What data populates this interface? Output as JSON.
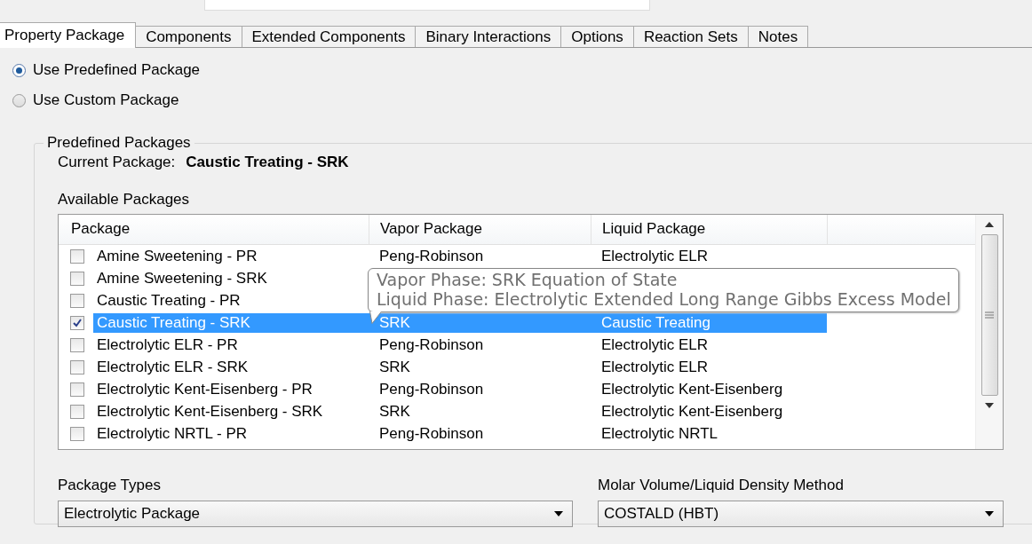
{
  "tabs": [
    {
      "label": "Property Package",
      "selected": true
    },
    {
      "label": "Components",
      "selected": false
    },
    {
      "label": "Extended Components",
      "selected": false
    },
    {
      "label": "Binary Interactions",
      "selected": false
    },
    {
      "label": "Options",
      "selected": false
    },
    {
      "label": "Reaction Sets",
      "selected": false
    },
    {
      "label": "Notes",
      "selected": false
    }
  ],
  "package_mode": [
    {
      "label": "Use Predefined Package",
      "selected": true
    },
    {
      "label": "Use Custom Package",
      "selected": false
    }
  ],
  "predefined_packages": {
    "title": "Predefined Packages",
    "current_label": "Current Package:",
    "current_value": "Caustic Treating - SRK",
    "available_label": "Available Packages",
    "columns": [
      "Package",
      "Vapor Package",
      "Liquid Package"
    ],
    "rows": [
      {
        "package": "Amine Sweetening - PR",
        "vapor": "Peng-Robinson",
        "liquid": "Electrolytic ELR",
        "checked": false,
        "selected": false
      },
      {
        "package": "Amine Sweetening - SRK",
        "checked": false,
        "selected": false
      },
      {
        "package": "Caustic Treating - PR",
        "checked": false,
        "selected": false
      },
      {
        "package": "Caustic Treating - SRK",
        "vapor": "SRK",
        "liquid": "Caustic Treating",
        "checked": true,
        "selected": true
      },
      {
        "package": "Electrolytic ELR - PR",
        "vapor": "Peng-Robinson",
        "liquid": "Electrolytic ELR",
        "checked": false,
        "selected": false
      },
      {
        "package": "Electrolytic ELR - SRK",
        "vapor": "SRK",
        "liquid": "Electrolytic ELR",
        "checked": false,
        "selected": false
      },
      {
        "package": "Electrolytic Kent-Eisenberg - PR",
        "vapor": "Peng-Robinson",
        "liquid": "Electrolytic Kent-Eisenberg",
        "checked": false,
        "selected": false
      },
      {
        "package": "Electrolytic Kent-Eisenberg - SRK",
        "vapor": "SRK",
        "liquid": "Electrolytic Kent-Eisenberg",
        "checked": false,
        "selected": false
      },
      {
        "package": "Electrolytic NRTL - PR",
        "vapor": "Peng-Robinson",
        "liquid": "Electrolytic NRTL",
        "checked": false,
        "selected": false
      }
    ],
    "tooltip": [
      "Vapor Phase: SRK Equation of State",
      "Liquid Phase: Electrolytic Extended Long Range Gibbs Excess Model"
    ],
    "package_types": {
      "label": "Package Types",
      "value": "Electrolytic Package"
    },
    "density_method": {
      "label": "Molar Volume/Liquid Density Method",
      "value": "COSTALD (HBT)"
    }
  }
}
